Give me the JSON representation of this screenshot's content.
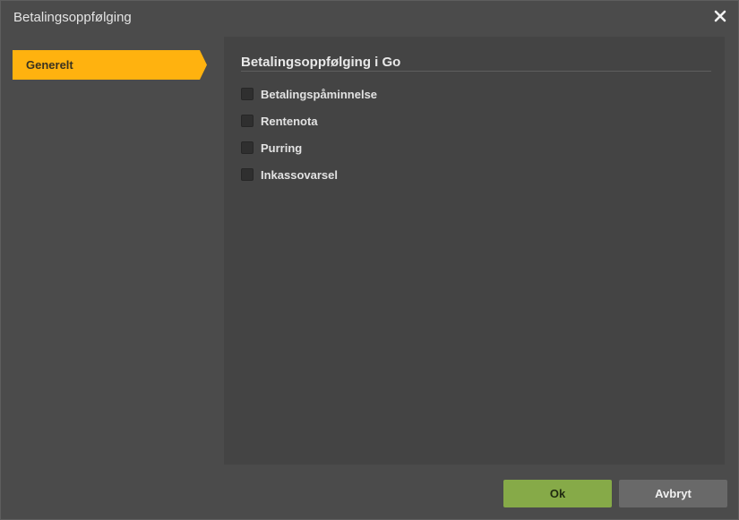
{
  "dialog": {
    "title": "Betalingsoppfølging",
    "close_icon": "close-icon"
  },
  "sidebar": {
    "items": [
      {
        "label": "Generelt",
        "active": true
      }
    ]
  },
  "section": {
    "title": "Betalingsoppfølging i Go",
    "options": [
      {
        "label": "Betalingspåminnelse",
        "checked": false
      },
      {
        "label": "Rentenota",
        "checked": false
      },
      {
        "label": "Purring",
        "checked": false
      },
      {
        "label": "Inkassovarsel",
        "checked": false
      }
    ]
  },
  "footer": {
    "ok_label": "Ok",
    "cancel_label": "Avbryt"
  },
  "colors": {
    "accent": "#ffb20f",
    "ok": "#86aa48",
    "cancel": "#696969"
  }
}
